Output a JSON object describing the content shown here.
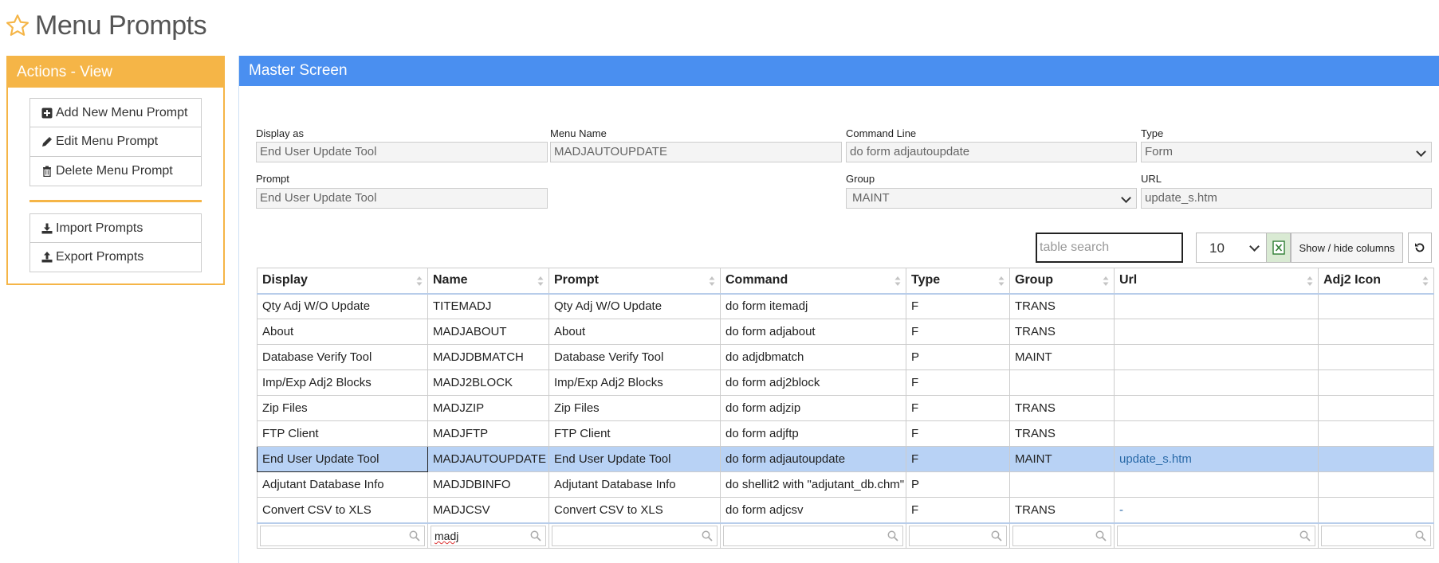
{
  "page": {
    "title": "Menu Prompts"
  },
  "colors": {
    "accent": "#f5b547",
    "primary": "#4a8ff0",
    "selected_row": "#b8d2f5",
    "link": "#2a6aa8"
  },
  "actions": {
    "title": "Actions - View",
    "buttons": [
      {
        "label": "Add New Menu Prompt",
        "icon": "plus-square-icon"
      },
      {
        "label": "Edit Menu Prompt",
        "icon": "pencil-icon"
      },
      {
        "label": "Delete Menu Prompt",
        "icon": "trash-icon"
      }
    ],
    "buttons2": [
      {
        "label": "Import Prompts",
        "icon": "download-icon"
      },
      {
        "label": "Export Prompts",
        "icon": "upload-icon"
      }
    ]
  },
  "master": {
    "title": "Master Screen",
    "form": {
      "display_as": {
        "label": "Display as",
        "value": "End User Update Tool"
      },
      "menu_name": {
        "label": "Menu Name",
        "value": "MADJAUTOUPDATE"
      },
      "command_line": {
        "label": "Command Line",
        "value": "do form adjautoupdate"
      },
      "type": {
        "label": "Type",
        "value": "Form"
      },
      "prompt": {
        "label": "Prompt",
        "value": "End User Update Tool"
      },
      "group": {
        "label": "Group",
        "value": "MAINT"
      },
      "url": {
        "label": "URL",
        "value": "update_s.htm"
      }
    },
    "toolbar": {
      "search_placeholder": "table search",
      "page_size": "10",
      "columns_label": "Show / hide columns"
    },
    "table": {
      "columns": [
        "Display",
        "Name",
        "Prompt",
        "Command",
        "Type",
        "Group",
        "Url",
        "Adj2 Icon"
      ],
      "rows": [
        [
          "Qty Adj W/O Update",
          "TITEMADJ",
          "Qty Adj W/O Update",
          "do form itemadj",
          "F",
          "TRANS",
          "",
          ""
        ],
        [
          "About",
          "MADJABOUT",
          "About",
          "do form adjabout",
          "F",
          "TRANS",
          "",
          ""
        ],
        [
          "Database Verify Tool",
          "MADJDBMATCH",
          "Database Verify Tool",
          "do adjdbmatch",
          "P",
          "MAINT",
          "",
          ""
        ],
        [
          "Imp/Exp Adj2 Blocks",
          "MADJ2BLOCK",
          "Imp/Exp Adj2 Blocks",
          "do form adj2block",
          "F",
          "",
          "",
          ""
        ],
        [
          "Zip Files",
          "MADJZIP",
          "Zip Files",
          "do form adjzip",
          "F",
          "TRANS",
          "",
          ""
        ],
        [
          "FTP Client",
          "MADJFTP",
          "FTP Client",
          "do form adjftp",
          "F",
          "TRANS",
          "",
          ""
        ],
        [
          "End User Update Tool",
          "MADJAUTOUPDATE",
          "End User Update Tool",
          "do form adjautoupdate",
          "F",
          "MAINT",
          "update_s.htm",
          ""
        ],
        [
          "Adjutant Database Info",
          "MADJDBINFO",
          "Adjutant Database Info",
          "do shellit2 with \"adjutant_db.chm\"",
          "P",
          "",
          "",
          ""
        ],
        [
          "Convert CSV to XLS",
          "MADJCSV",
          "Convert CSV to XLS",
          "do form adjcsv",
          "F",
          "TRANS",
          "-",
          ""
        ]
      ],
      "selected_row": 6,
      "filters": [
        "",
        "madj",
        "",
        "",
        "",
        "",
        "",
        ""
      ]
    }
  }
}
